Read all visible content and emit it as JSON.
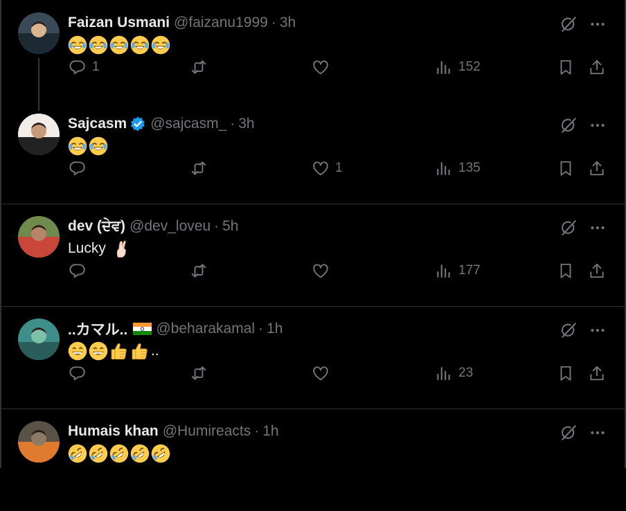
{
  "tweets": [
    {
      "name": "Faizan Usmani",
      "handle": "@faizanu1999",
      "time": "3h",
      "verified": false,
      "flag": false,
      "text": "",
      "emojis": [
        "joy",
        "joy",
        "joy",
        "joy",
        "joy"
      ],
      "trailing_text": "",
      "replies": "1",
      "reposts": "",
      "likes": "",
      "views": "152",
      "avatar_colors": [
        "#3b4a57",
        "#d9b48f",
        "#1d2a33"
      ]
    },
    {
      "name": "Sajcasm",
      "handle": "@sajcasm_",
      "time": "3h",
      "verified": true,
      "flag": false,
      "text": "",
      "emojis": [
        "joy",
        "joy"
      ],
      "trailing_text": "",
      "replies": "",
      "reposts": "",
      "likes": "1",
      "views": "135",
      "avatar_colors": [
        "#f2ede8",
        "#c99a7a",
        "#222222"
      ]
    },
    {
      "name": "dev (ਦੇਵ)",
      "handle": "@dev_loveu",
      "time": "5h",
      "verified": false,
      "flag": false,
      "text": "Lucky",
      "emojis": [
        "crossed-fingers"
      ],
      "trailing_text": "",
      "replies": "",
      "reposts": "",
      "likes": "",
      "views": "177",
      "avatar_colors": [
        "#6e8a4c",
        "#b7856a",
        "#c9473a"
      ]
    },
    {
      "name": "..カマル..",
      "handle": "@beharakamal",
      "time": "1h",
      "verified": false,
      "flag": true,
      "text": "",
      "emojis": [
        "grin",
        "grin",
        "thumbs-up",
        "thumbs-up"
      ],
      "trailing_text": "..",
      "replies": "",
      "reposts": "",
      "likes": "",
      "views": "23",
      "avatar_colors": [
        "#3e8f8a",
        "#7fc1a8",
        "#2a5c5a"
      ]
    },
    {
      "name": "Humais khan",
      "handle": "@Humireacts",
      "time": "1h",
      "verified": false,
      "flag": false,
      "text": "",
      "emojis": [
        "rofl",
        "rofl",
        "rofl",
        "rofl",
        "rofl"
      ],
      "trailing_text": "",
      "replies": "",
      "reposts": "",
      "likes": "",
      "views": "",
      "avatar_colors": [
        "#5a5247",
        "#8a7a66",
        "#e07a2f"
      ]
    }
  ],
  "colors": {
    "background": "#000000",
    "text": "#e7e9ea",
    "muted": "#71767b",
    "divider": "#2f3336",
    "verified": "#1d9bf0"
  },
  "icons": {
    "reply": "reply-icon",
    "repost": "repost-icon",
    "like": "heart-icon",
    "views": "views-icon",
    "bookmark": "bookmark-icon",
    "share": "share-icon",
    "grok": "grok-icon",
    "more": "more-icon"
  }
}
